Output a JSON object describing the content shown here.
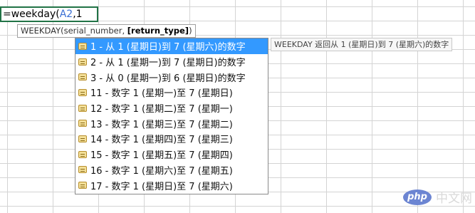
{
  "formula_bar": {
    "prefix": "=weekday(",
    "ref": "A2",
    "suffix": ",1"
  },
  "tooltip": {
    "func": "WEEKDAY(serial_number, ",
    "arg_bold": "[return_type]",
    "close": ")"
  },
  "options": [
    {
      "label": "1 - 从 1 (星期日)到 7 (星期六)的数字",
      "selected": true
    },
    {
      "label": "2 - 从 1 (星期一)到 7 (星期日)的数字"
    },
    {
      "label": "3 - 从 0 (星期一)到 6 (星期日)的数字"
    },
    {
      "label": "11 - 数字 1 (星期一)至 7 (星期日)"
    },
    {
      "label": "12 - 数字 1 (星期二)至 7 (星期一)"
    },
    {
      "label": "13 - 数字 1 (星期三)至 7 (星期二)"
    },
    {
      "label": "14 - 数字 1 (星期四)至 7 (星期三)"
    },
    {
      "label": "15 - 数字 1 (星期五)至 7 (星期四)"
    },
    {
      "label": "16 - 数字 1 (星期六)至 7 (星期五)"
    },
    {
      "label": "17 - 数字 1 (星期日)至 7 (星期六)"
    }
  ],
  "description": "WEEKDAY 返回从 1 (星期日)到 7 (星期六)的数字",
  "watermark": {
    "logo": "php",
    "text": "中文网"
  }
}
